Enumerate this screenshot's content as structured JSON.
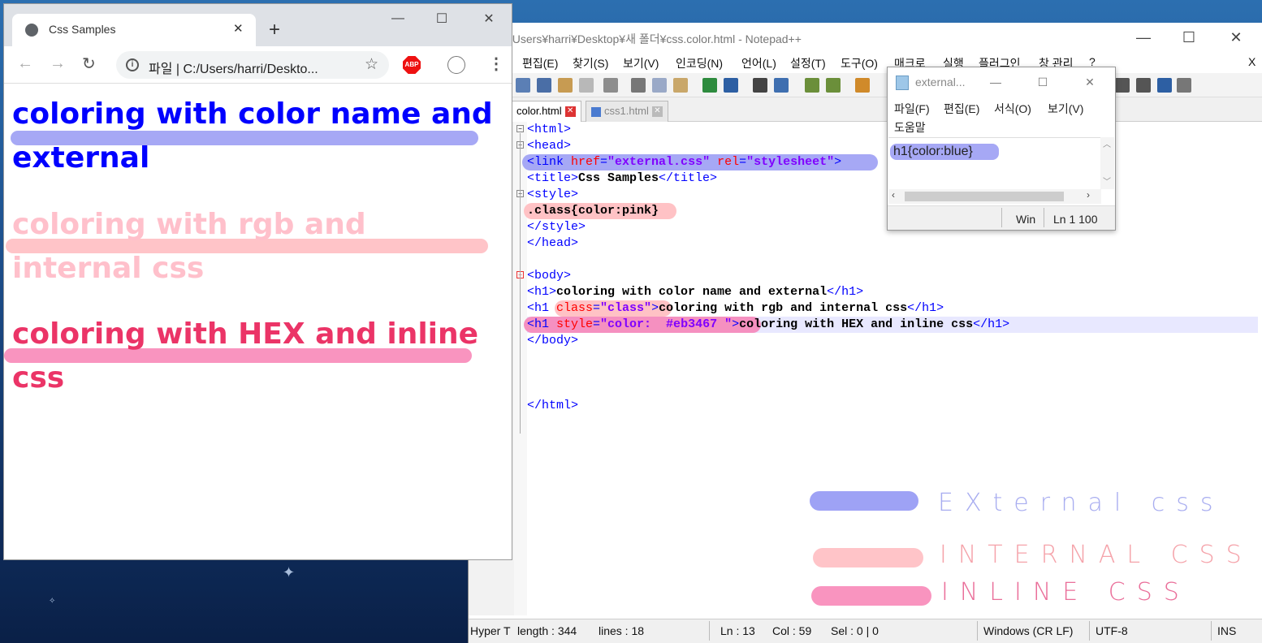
{
  "desktop": {
    "bg": "#1d4f8c"
  },
  "chrome": {
    "tab_title": "Css Samples",
    "address": "파일  |  C:/Users/harri/Deskto...",
    "abp": "ABP",
    "page": {
      "h1_blue": "coloring with color name and external",
      "h1_pink": "coloring with rgb and internal css",
      "h1_hex": "coloring with HEX and inline css",
      "colors": {
        "blue": "#0000ff",
        "pink": "#ffc0cb",
        "hex": "#eb3467"
      }
    }
  },
  "notepadpp": {
    "title": "¥Users¥harri¥Desktop¥새 폴더¥css.color.html - Notepad++",
    "menu": [
      "편집(E)",
      "찾기(S)",
      "보기(V)",
      "인코딩(N)",
      "언어(L)",
      "설정(T)",
      "도구(O)",
      "매크로",
      "실행",
      "플러그인",
      "창 관리",
      "?"
    ],
    "menu_close": "X",
    "tabs": [
      {
        "label": "color.html",
        "close": "✕"
      },
      {
        "label": "css1.html",
        "close": "✕"
      }
    ],
    "code": {
      "l1": "<html>",
      "l2": "<head>",
      "l3_tag": "<link ",
      "l3_a1": "href",
      "l3_v1": "\"external.css\"",
      "l3_a2": "rel",
      "l3_v2": "\"stylesheet\"",
      "l3_end": ">",
      "l4_open": "<title>",
      "l4_text": "Css Samples",
      "l4_close": "</title>",
      "l5": "<style>",
      "l6": ".class{color:pink}",
      "l7": "</style>",
      "l8": "</head>",
      "l10": "<body>",
      "l11_open": "<h1>",
      "l11_text": "coloring with color name and external",
      "l11_close": "</h1>",
      "l12_tag": "<h1 ",
      "l12_attr": "class",
      "l12_val": "\"class\"",
      "l12_end": ">",
      "l12_text": "coloring with rgb and internal css",
      "l12_close": "</h1>",
      "l13_tag": "<h1 ",
      "l13_attr": "style",
      "l13_val": "\"color:  #eb3467 \"",
      "l13_end": ">",
      "l13_text": "coloring with HEX and inline css",
      "l13_close": "</h1>",
      "l14": "</body>",
      "l18": "</html>",
      "eq": "="
    },
    "status": {
      "type": "Hyper T",
      "length": "length : 344",
      "lines": "lines : 18",
      "ln": "Ln : 13",
      "col": "Col : 59",
      "sel": "Sel : 0 | 0",
      "eol": "Windows (CR LF)",
      "enc": "UTF-8",
      "ins": "INS"
    }
  },
  "mini_notepad": {
    "title": "external...",
    "menu": [
      "파일(F)",
      "편집(E)",
      "서식(O)",
      "보기(V)",
      "도움말"
    ],
    "content": "h1{color:blue}",
    "status_win": "Win",
    "status_ln": "Ln 1 100"
  },
  "legend": [
    {
      "label": "EXternal  css",
      "text_color": "#a8adf0",
      "bar_color": "#9ea2f5"
    },
    {
      "label": "INTERNAL  CSS",
      "text_color": "#f5a3aa",
      "bar_color": "#ffc4c8"
    },
    {
      "label": "INLINE  CSS",
      "text_color": "#ea6f9a",
      "bar_color": "#f994bf"
    }
  ],
  "window_controls": {
    "min": "—",
    "max": "☐",
    "close": "✕"
  }
}
